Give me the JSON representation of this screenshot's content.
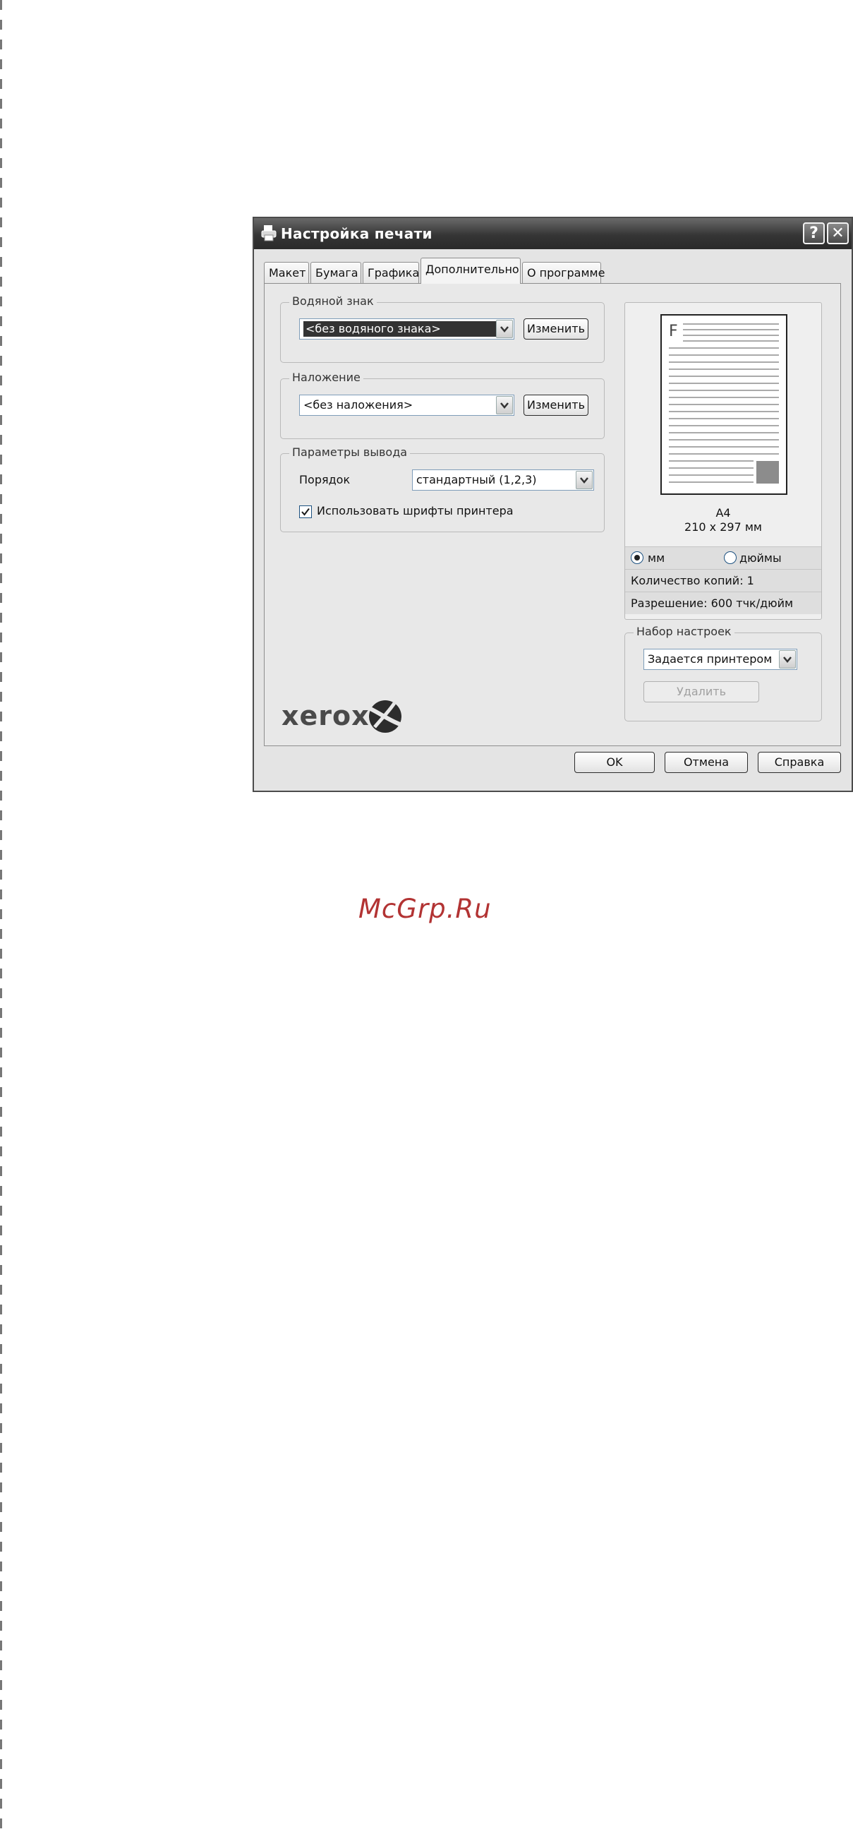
{
  "window": {
    "title": "Настройка печати",
    "help_label": "?",
    "close_label": "✕"
  },
  "tabs": [
    {
      "label": "Макет"
    },
    {
      "label": "Бумага"
    },
    {
      "label": "Графика"
    },
    {
      "label": "Дополнительно",
      "active": true
    },
    {
      "label": "О программе"
    }
  ],
  "watermark_group": {
    "label": "Водяной знак",
    "value": "<без водяного знака>",
    "edit_label": "Изменить"
  },
  "overlay_group": {
    "label": "Наложение",
    "value": "<без наложения>",
    "edit_label": "Изменить"
  },
  "output_group": {
    "label": "Параметры вывода",
    "order_label": "Порядок",
    "order_value": "стандартный (1,2,3)",
    "use_printer_fonts_label": "Использовать шрифты принтера",
    "use_printer_fonts_checked": true
  },
  "preview": {
    "page_letter": "F",
    "paper_name": "A4",
    "paper_size": "210 x 297 мм",
    "unit_mm": "мм",
    "unit_inches": "дюймы",
    "unit_selected": "мм",
    "copies_text": "Количество копий: 1",
    "resolution_text": "Разрешение: 600 тчк/дюйм"
  },
  "favorites": {
    "label": "Набор настроек",
    "value": "Задается принтером",
    "delete_label": "Удалить"
  },
  "brand": {
    "logo_text": "xerox"
  },
  "buttons": {
    "ok": "OK",
    "cancel": "Отмена",
    "help": "Справка"
  },
  "footer_watermark": "McGrp.Ru"
}
